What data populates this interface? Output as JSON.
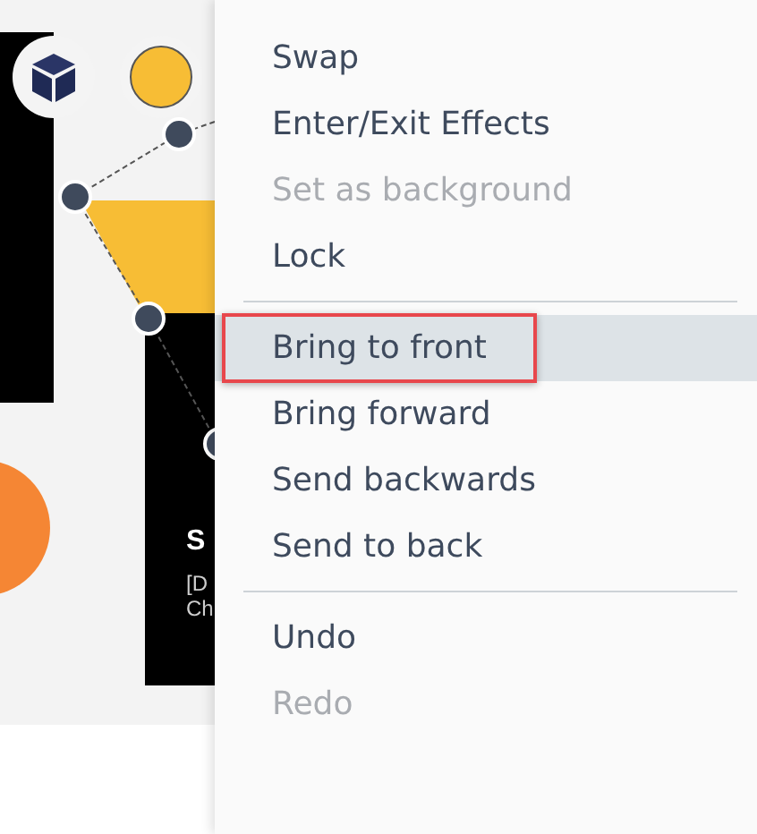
{
  "slide": {
    "card_title": "S",
    "card_text": [
      "[D",
      "Ch"
    ]
  },
  "context_menu": {
    "groups": [
      [
        {
          "label": "Swap",
          "disabled": false,
          "selected": false
        },
        {
          "label": "Enter/Exit Effects",
          "disabled": false,
          "selected": false
        },
        {
          "label": "Set as background",
          "disabled": true,
          "selected": false
        },
        {
          "label": "Lock",
          "disabled": false,
          "selected": false
        }
      ],
      [
        {
          "label": "Bring to front",
          "disabled": false,
          "selected": true
        },
        {
          "label": "Bring forward",
          "disabled": false,
          "selected": false
        },
        {
          "label": "Send backwards",
          "disabled": false,
          "selected": false
        },
        {
          "label": "Send to back",
          "disabled": false,
          "selected": false
        }
      ],
      [
        {
          "label": "Undo",
          "disabled": false,
          "selected": false
        },
        {
          "label": "Redo",
          "disabled": true,
          "selected": false
        }
      ]
    ]
  }
}
